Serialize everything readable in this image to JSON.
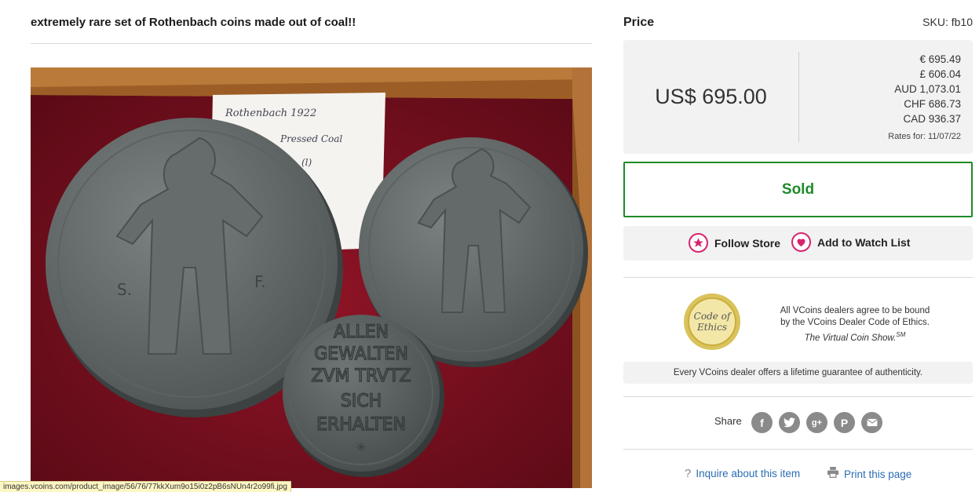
{
  "item": {
    "title": "extremely rare set of Rothenbach coins made out of coal!!"
  },
  "photo": {
    "note_text": [
      "Rothenbach 1922",
      "Pressed Coal",
      "(l)"
    ],
    "large_coin_legend": "ALLEN GEWALTEN ZVM TRVTZ SICH ERHALTEN",
    "large_coin_initials": [
      "S.",
      "F."
    ],
    "small_coin_lines": [
      "ALLEN",
      "GEWALTEN",
      "ZVM TRVTZ",
      "SICH",
      "ERHALTEN"
    ]
  },
  "status_bar": {
    "url": "images.vcoins.com/product_image/56/76/77kkXum9o15i0z2pB6sNUn4r2o99fi.jpg"
  },
  "pricing": {
    "label": "Price",
    "sku": "SKU: fb10",
    "main_price": "US$ 695.00",
    "conversions": [
      "€ 695.49",
      "£ 606.04",
      "AUD 1,073.01",
      "CHF 686.73",
      "CAD 936.37"
    ],
    "rates_date": "Rates for: 11/07/22"
  },
  "sold_label": "Sold",
  "actions": {
    "follow_store": "Follow Store",
    "watch_list": "Add to Watch List"
  },
  "ethics": {
    "seal_line1": "Code of",
    "seal_line2": "Ethics",
    "text_line1": "All VCoins dealers agree to be bound",
    "text_line2": "by the VCoins Dealer Code of Ethics.",
    "text_line3": "The Virtual Coin Show.",
    "text_sup": "SM"
  },
  "guarantee": "Every VCoins dealer offers a lifetime guarantee of authenticity.",
  "share": {
    "label": "Share",
    "icons": [
      "facebook-icon",
      "twitter-icon",
      "google-plus-icon",
      "pinterest-icon",
      "email-icon"
    ]
  },
  "footer": {
    "inquire": "Inquire about this item",
    "print": "Print this page"
  },
  "colors": {
    "sold_green": "#1e8b27",
    "accent_pink": "#d6246e",
    "link_blue": "#2a6db5"
  }
}
